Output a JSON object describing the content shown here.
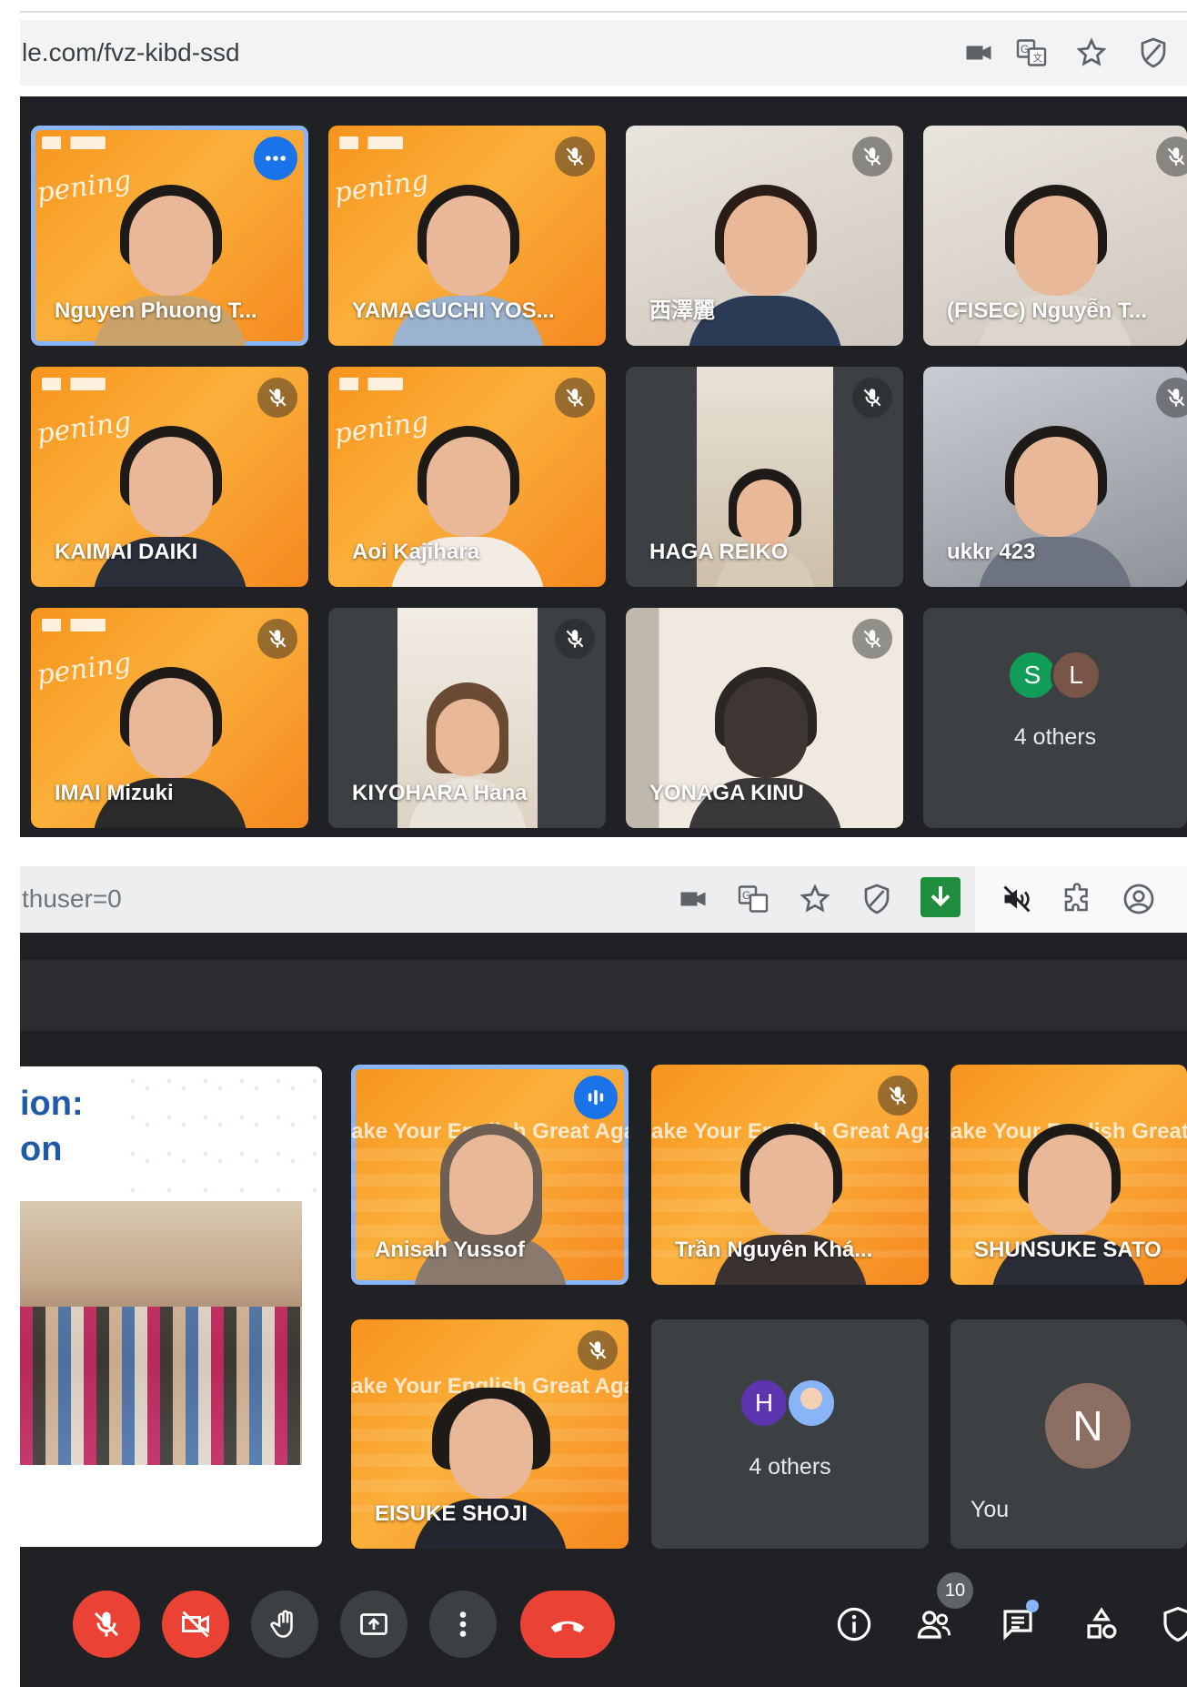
{
  "browser_top": {
    "url": "le.com/fvz-kibd-ssd",
    "icons": [
      "camera-icon",
      "translate-icon",
      "star-icon",
      "shield-icon"
    ]
  },
  "meet_top": {
    "tiles": [
      {
        "name": "Nguyen Phuong T...",
        "status": "more-options",
        "background": "orange",
        "active": true
      },
      {
        "name": "YAMAGUCHI YOS...",
        "status": "muted",
        "background": "orange"
      },
      {
        "name": "西澤麗",
        "status": "muted",
        "background": "photo-light"
      },
      {
        "name": "(FISEC) Nguyễn T...",
        "status": "muted",
        "background": "photo-light"
      },
      {
        "name": "KAIMAI DAIKI",
        "status": "muted",
        "background": "orange"
      },
      {
        "name": "Aoi Kajihara",
        "status": "muted",
        "background": "orange"
      },
      {
        "name": "HAGA REIKO",
        "status": "muted",
        "background": "photo-dark"
      },
      {
        "name": "ukkr 423",
        "status": "muted",
        "background": "photo-light"
      },
      {
        "name": "IMAI Mizuki",
        "status": "muted",
        "background": "orange"
      },
      {
        "name": "KIYOHARA Hana",
        "status": "muted",
        "background": "photo-dark"
      },
      {
        "name": "YONAGA KINU",
        "status": "muted",
        "background": "photo-light"
      }
    ],
    "others": {
      "avatars": [
        "S",
        "L"
      ],
      "label": "4 others"
    }
  },
  "browser_bottom": {
    "url": "thuser=0",
    "icons": [
      "camera-icon",
      "translate-icon",
      "star-icon",
      "shield-icon",
      "download-icon",
      "speaker-muted-icon",
      "extensions-icon",
      "profile-icon"
    ]
  },
  "meet_bottom": {
    "slide": {
      "line1": "ion:",
      "line2": "on"
    },
    "banner_text": "ake Your English  Great Aga",
    "tiles": [
      {
        "name": "Anisah Yussof",
        "status": "speaking",
        "active": true
      },
      {
        "name": "Trần Nguyên Khá...",
        "status": "muted"
      },
      {
        "name": "SHUNSUKE SATO",
        "status": "muted"
      },
      {
        "name": "EISUKE SHOJI",
        "status": "muted"
      }
    ],
    "others": {
      "avatars": [
        "H",
        ""
      ],
      "label": "4 others"
    },
    "self": {
      "initial": "N",
      "label": "You"
    },
    "participants_count": "10"
  },
  "colors": {
    "accent": "#1a73e8",
    "meet_bg": "#202124",
    "tile_bg": "#3c4043",
    "danger": "#ea4335",
    "orange": "#f7941d"
  }
}
